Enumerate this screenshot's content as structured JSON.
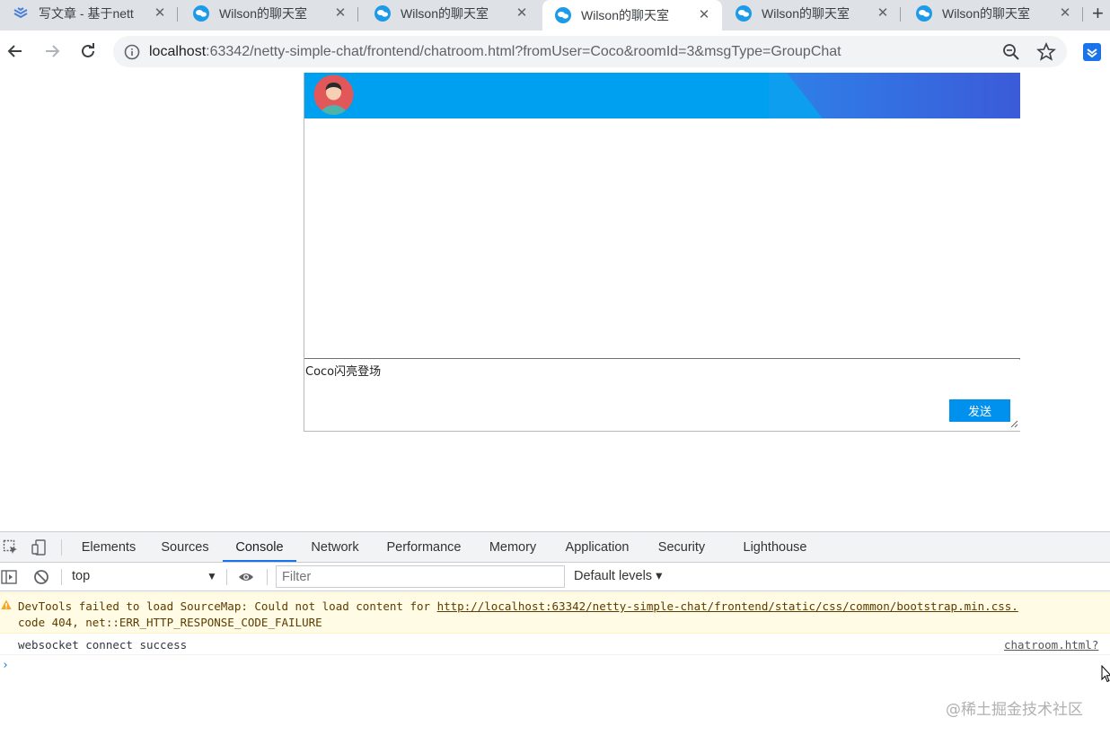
{
  "browser": {
    "tabs": [
      {
        "title": "写文章 - 基于nett",
        "icon": "csdn-icon",
        "active": false
      },
      {
        "title": "Wilson的聊天室",
        "icon": "chat-icon",
        "active": false
      },
      {
        "title": "Wilson的聊天室",
        "icon": "chat-icon",
        "active": false
      },
      {
        "title": "Wilson的聊天室",
        "icon": "chat-icon",
        "active": true
      },
      {
        "title": "Wilson的聊天室",
        "icon": "chat-icon",
        "active": false
      },
      {
        "title": "Wilson的聊天室",
        "icon": "chat-icon",
        "active": false
      }
    ],
    "url": {
      "host": "localhost",
      "rest": ":63342/netty-simple-chat/frontend/chatroom.html?fromUser=Coco&roomId=3&msgType=GroupChat"
    }
  },
  "chat": {
    "message_text": "Coco闪亮登场",
    "send_label": "发送",
    "header_color": "#00a0f0"
  },
  "devtools": {
    "tabs": [
      "Elements",
      "Sources",
      "Console",
      "Network",
      "Performance",
      "Memory",
      "Application",
      "Security",
      "Lighthouse"
    ],
    "active_tab": "Console",
    "context": "top",
    "filter_placeholder": "Filter",
    "levels_label": "Default levels",
    "messages": {
      "warning": {
        "prefix": "DevTools failed to load SourceMap: Could not load content for ",
        "link": "http://localhost:63342/netty-simple-chat/frontend/static/css/common/bootstrap.min.css.",
        "line2": "code 404, net::ERR_HTTP_RESPONSE_CODE_FAILURE"
      },
      "log": {
        "text": "websocket connect success",
        "source": "chatroom.html?"
      }
    },
    "prompt": "›"
  },
  "watermark": "@稀土掘金技术社区"
}
